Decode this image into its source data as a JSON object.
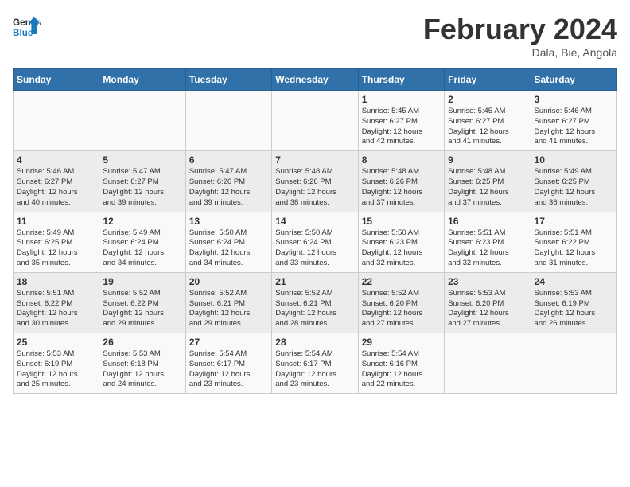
{
  "header": {
    "logo_general": "General",
    "logo_blue": "Blue",
    "month_title": "February 2024",
    "location": "Dala, Bie, Angola"
  },
  "weekdays": [
    "Sunday",
    "Monday",
    "Tuesday",
    "Wednesday",
    "Thursday",
    "Friday",
    "Saturday"
  ],
  "weeks": [
    [
      {
        "day": "",
        "info": ""
      },
      {
        "day": "",
        "info": ""
      },
      {
        "day": "",
        "info": ""
      },
      {
        "day": "",
        "info": ""
      },
      {
        "day": "1",
        "info": "Sunrise: 5:45 AM\nSunset: 6:27 PM\nDaylight: 12 hours\nand 42 minutes."
      },
      {
        "day": "2",
        "info": "Sunrise: 5:45 AM\nSunset: 6:27 PM\nDaylight: 12 hours\nand 41 minutes."
      },
      {
        "day": "3",
        "info": "Sunrise: 5:46 AM\nSunset: 6:27 PM\nDaylight: 12 hours\nand 41 minutes."
      }
    ],
    [
      {
        "day": "4",
        "info": "Sunrise: 5:46 AM\nSunset: 6:27 PM\nDaylight: 12 hours\nand 40 minutes."
      },
      {
        "day": "5",
        "info": "Sunrise: 5:47 AM\nSunset: 6:27 PM\nDaylight: 12 hours\nand 39 minutes."
      },
      {
        "day": "6",
        "info": "Sunrise: 5:47 AM\nSunset: 6:26 PM\nDaylight: 12 hours\nand 39 minutes."
      },
      {
        "day": "7",
        "info": "Sunrise: 5:48 AM\nSunset: 6:26 PM\nDaylight: 12 hours\nand 38 minutes."
      },
      {
        "day": "8",
        "info": "Sunrise: 5:48 AM\nSunset: 6:26 PM\nDaylight: 12 hours\nand 37 minutes."
      },
      {
        "day": "9",
        "info": "Sunrise: 5:48 AM\nSunset: 6:25 PM\nDaylight: 12 hours\nand 37 minutes."
      },
      {
        "day": "10",
        "info": "Sunrise: 5:49 AM\nSunset: 6:25 PM\nDaylight: 12 hours\nand 36 minutes."
      }
    ],
    [
      {
        "day": "11",
        "info": "Sunrise: 5:49 AM\nSunset: 6:25 PM\nDaylight: 12 hours\nand 35 minutes."
      },
      {
        "day": "12",
        "info": "Sunrise: 5:49 AM\nSunset: 6:24 PM\nDaylight: 12 hours\nand 34 minutes."
      },
      {
        "day": "13",
        "info": "Sunrise: 5:50 AM\nSunset: 6:24 PM\nDaylight: 12 hours\nand 34 minutes."
      },
      {
        "day": "14",
        "info": "Sunrise: 5:50 AM\nSunset: 6:24 PM\nDaylight: 12 hours\nand 33 minutes."
      },
      {
        "day": "15",
        "info": "Sunrise: 5:50 AM\nSunset: 6:23 PM\nDaylight: 12 hours\nand 32 minutes."
      },
      {
        "day": "16",
        "info": "Sunrise: 5:51 AM\nSunset: 6:23 PM\nDaylight: 12 hours\nand 32 minutes."
      },
      {
        "day": "17",
        "info": "Sunrise: 5:51 AM\nSunset: 6:22 PM\nDaylight: 12 hours\nand 31 minutes."
      }
    ],
    [
      {
        "day": "18",
        "info": "Sunrise: 5:51 AM\nSunset: 6:22 PM\nDaylight: 12 hours\nand 30 minutes."
      },
      {
        "day": "19",
        "info": "Sunrise: 5:52 AM\nSunset: 6:22 PM\nDaylight: 12 hours\nand 29 minutes."
      },
      {
        "day": "20",
        "info": "Sunrise: 5:52 AM\nSunset: 6:21 PM\nDaylight: 12 hours\nand 29 minutes."
      },
      {
        "day": "21",
        "info": "Sunrise: 5:52 AM\nSunset: 6:21 PM\nDaylight: 12 hours\nand 28 minutes."
      },
      {
        "day": "22",
        "info": "Sunrise: 5:52 AM\nSunset: 6:20 PM\nDaylight: 12 hours\nand 27 minutes."
      },
      {
        "day": "23",
        "info": "Sunrise: 5:53 AM\nSunset: 6:20 PM\nDaylight: 12 hours\nand 27 minutes."
      },
      {
        "day": "24",
        "info": "Sunrise: 5:53 AM\nSunset: 6:19 PM\nDaylight: 12 hours\nand 26 minutes."
      }
    ],
    [
      {
        "day": "25",
        "info": "Sunrise: 5:53 AM\nSunset: 6:19 PM\nDaylight: 12 hours\nand 25 minutes."
      },
      {
        "day": "26",
        "info": "Sunrise: 5:53 AM\nSunset: 6:18 PM\nDaylight: 12 hours\nand 24 minutes."
      },
      {
        "day": "27",
        "info": "Sunrise: 5:54 AM\nSunset: 6:17 PM\nDaylight: 12 hours\nand 23 minutes."
      },
      {
        "day": "28",
        "info": "Sunrise: 5:54 AM\nSunset: 6:17 PM\nDaylight: 12 hours\nand 23 minutes."
      },
      {
        "day": "29",
        "info": "Sunrise: 5:54 AM\nSunset: 6:16 PM\nDaylight: 12 hours\nand 22 minutes."
      },
      {
        "day": "",
        "info": ""
      },
      {
        "day": "",
        "info": ""
      }
    ]
  ]
}
